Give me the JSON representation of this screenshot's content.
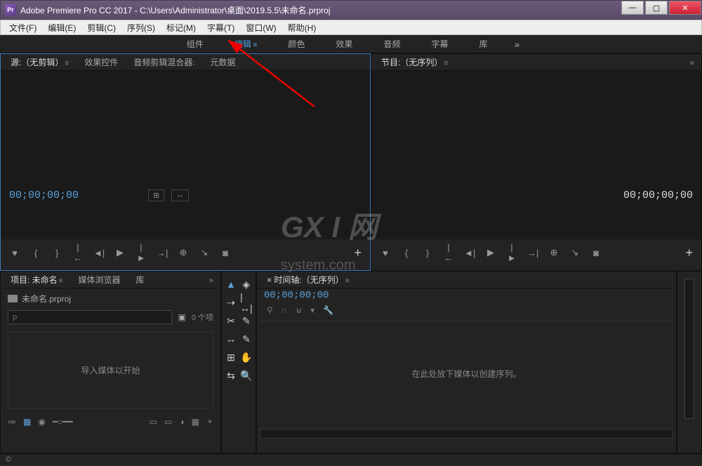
{
  "window": {
    "app_icon_text": "Pr",
    "title": "Adobe Premiere Pro CC 2017 - C:\\Users\\Administrator\\桌面\\2019.5.5\\未命名.prproj"
  },
  "menubar": {
    "items": [
      "文件(F)",
      "编辑(E)",
      "剪辑(C)",
      "序列(S)",
      "标记(M)",
      "字幕(T)",
      "窗口(W)",
      "帮助(H)"
    ]
  },
  "workspace": {
    "tabs": [
      "组件",
      "编辑",
      "颜色",
      "效果",
      "音频",
      "字幕",
      "库"
    ],
    "active_index": 1,
    "more": "»"
  },
  "source_panel": {
    "tabs": [
      "源:（无剪辑）",
      "效果控件",
      "音频剪辑混合器:",
      "元数据"
    ],
    "active_index": 0,
    "timecode_left": "00;00;00;00",
    "fit": "⊞",
    "step": "↔",
    "transport_icons": [
      "♥",
      "{",
      "}",
      "|←",
      "◄|",
      "▶",
      "|►",
      "→|",
      "⊕",
      "↘",
      "◙"
    ],
    "plus": "+"
  },
  "program_panel": {
    "title": "节目:（无序列）",
    "timecode_right": "00;00;00;00",
    "transport_icons": [
      "♥",
      "{",
      "}",
      "|←",
      "◄|",
      "▶",
      "|►",
      "→|",
      "⊕",
      "↘",
      "◙"
    ],
    "plus": "+"
  },
  "project_panel": {
    "tabs": [
      "项目: 未命名",
      "媒体浏览器",
      "库"
    ],
    "active_index": 0,
    "file_name": "未命名.prproj",
    "search_placeholder": "ρ",
    "filter_icon": "▣",
    "item_count": "0 个项",
    "drop_hint": "导入媒体以开始",
    "footer_icons": [
      "≔",
      "▦",
      "◉",
      "━○━━"
    ],
    "footer_right": [
      "▭",
      "▭",
      "◑",
      "▦",
      "⚬"
    ]
  },
  "tools": {
    "items": [
      "▲",
      "◈",
      "⇢",
      "|↔|",
      "✂",
      "✎",
      "↔",
      "✎",
      "⊞",
      "✋",
      "⇆",
      "🔍"
    ]
  },
  "timeline_panel": {
    "title": "× 时间轴:（无序列）",
    "timecode": "00;00;00;00",
    "tool_icons": [
      "⚲",
      "∩",
      "⊎",
      "▾",
      "🔧"
    ],
    "drop_hint": "在此处放下媒体以创建序列。"
  },
  "statusbar": {
    "text": "©"
  },
  "watermark": {
    "main": "GX  I 网",
    "sub": "system.com"
  }
}
